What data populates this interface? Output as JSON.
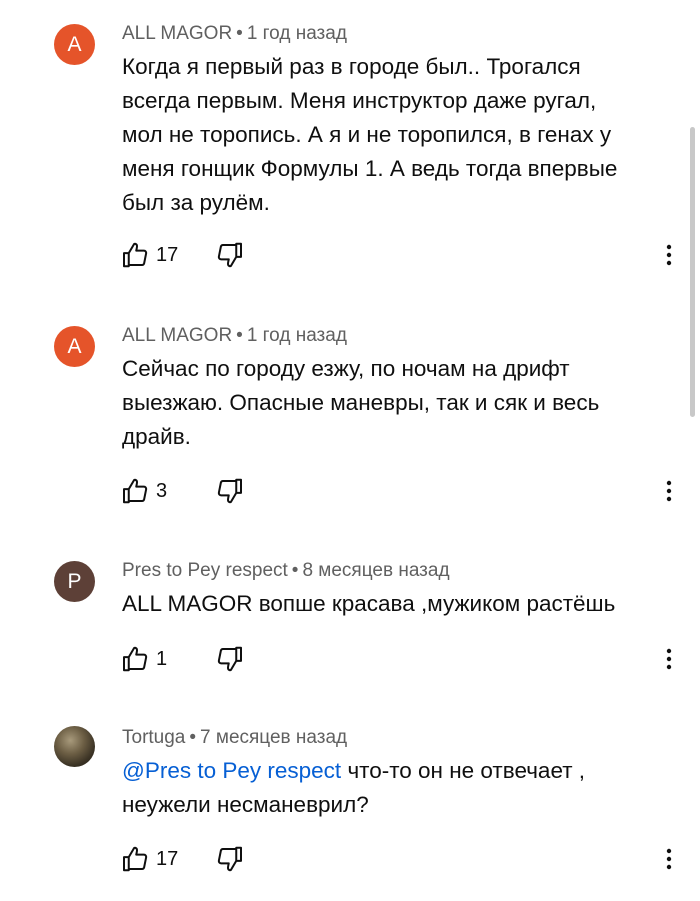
{
  "comments": [
    {
      "avatar_letter": "A",
      "avatar_color": "#e5542a",
      "author": "ALL MAGOR",
      "separator": "•",
      "time": "1 год назад",
      "text": "Когда я первый раз в городе был.. Трогался\nвсегда первым. Меня инструктор даже ругал,\nмол не торопись. А я и не торопился, в генах у\nменя гонщик Формулы 1. А ведь тогда впервые\nбыл за рулём.",
      "likes": "17"
    },
    {
      "avatar_letter": "A",
      "avatar_color": "#e5542a",
      "author": "ALL MAGOR",
      "separator": "•",
      "time": "1 год назад",
      "text": "Сейчас по городу езжу, по ночам на дрифт\nвыезжаю. Опасные маневры, так и сяк и весь\nдрайв.",
      "likes": "3"
    },
    {
      "avatar_letter": "P",
      "avatar_color": "#5d4037",
      "author": "Pres to Pey respect",
      "separator": "•",
      "time": "8 месяцев назад",
      "text": "ALL MAGOR вопше красава ,мужиком растёшь",
      "likes": "1"
    },
    {
      "author": "Tortuga",
      "separator": "•",
      "time": "7 месяцев назад",
      "mention": "@Pres to Pey respect",
      "text_after_mention": " что-то он не отвечает ,",
      "text_line2": "неужели несманеврил?",
      "likes": "17"
    }
  ],
  "icons": {
    "like": "thumb-up-icon",
    "dislike": "thumb-down-icon",
    "more": "more-vert-icon"
  },
  "colors": {
    "mention": "#065fd4",
    "meta": "#606060"
  }
}
